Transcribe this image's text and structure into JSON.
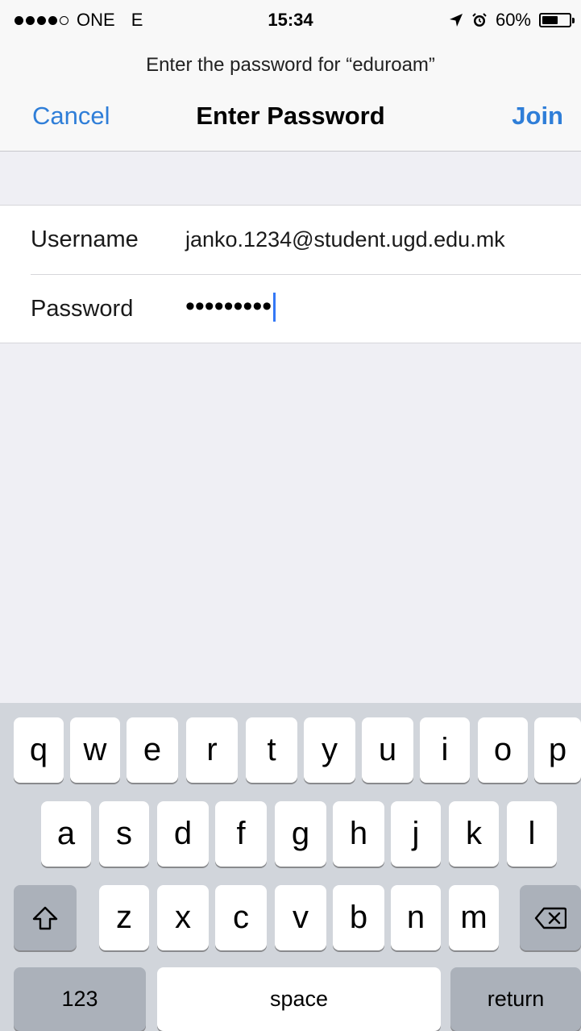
{
  "status_bar": {
    "carrier": "ONE",
    "network": "E",
    "time": "15:34",
    "battery": "60%",
    "battery_level": 0.6
  },
  "header": {
    "prompt": "Enter the password for “eduroam”",
    "title": "Enter Password",
    "cancel_label": "Cancel",
    "join_label": "Join"
  },
  "form": {
    "username_label": "Username",
    "username_value": "janko.1234@student.ugd.edu.mk",
    "password_label": "Password",
    "password_masked": "•••••••••"
  },
  "keyboard": {
    "row1": [
      "q",
      "w",
      "e",
      "r",
      "t",
      "y",
      "u",
      "i",
      "o",
      "p"
    ],
    "row2": [
      "a",
      "s",
      "d",
      "f",
      "g",
      "h",
      "j",
      "k",
      "l"
    ],
    "row3": [
      "z",
      "x",
      "c",
      "v",
      "b",
      "n",
      "m"
    ],
    "numbers_label": "123",
    "space_label": "space",
    "return_label": "return"
  },
  "colors": {
    "accent": "#2f7ed8",
    "caret": "#3478f6",
    "keyboard_bg": "#d1d5db",
    "key_dark": "#abb1ba"
  }
}
